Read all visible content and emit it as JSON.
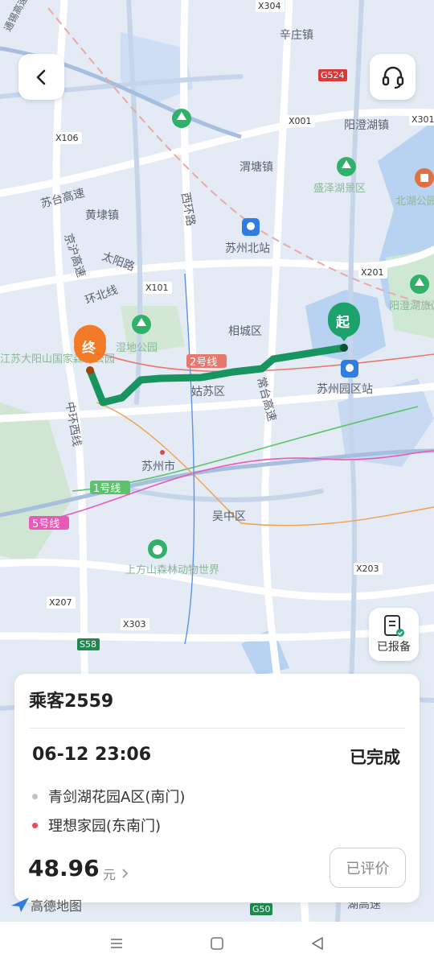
{
  "map": {
    "places": {
      "xinzhuang": "辛庄镇",
      "yangcheng": "阳澄湖镇",
      "weitang": "渭塘镇",
      "shenghu": "盛泽湖景区",
      "huangdai": "黄埭镇",
      "taiyang": "太阳路",
      "xihuan": "西环路",
      "suzhou_north": "苏州北站",
      "xiangcheng": "相城区",
      "gusu": "姑苏区",
      "suzhou_city": "苏州市",
      "wuzhong": "吴中区",
      "sip_station": "苏州园区站",
      "shangfangshan": "上方山森林动物世界",
      "huanbei": "环北线",
      "zhonghuan_west": "中环西线",
      "changtai": "常台高速",
      "sutai": "苏台高速",
      "jinghu": "京沪高速",
      "tonglu": "通锡高速",
      "jiangsu_forest": "江苏大阳山国家森林公园",
      "wetland": "湿地公园",
      "yangcheng_lake": "阳澄湖旅游度假区",
      "beihu": "北湖公园",
      "bottom_road": "湖高速"
    },
    "road_codes": [
      "X304",
      "G524",
      "X106",
      "X001",
      "X301",
      "X101",
      "X201",
      "X203",
      "X207",
      "X303",
      "S58",
      "G50"
    ],
    "metro": {
      "line1": "1号线",
      "line2": "2号线",
      "line5": "5号线"
    },
    "markers": {
      "start": "起",
      "end": "终"
    },
    "colors": {
      "route": "#179460",
      "start_marker": "#1ca26a",
      "end_marker": "#f37a27"
    }
  },
  "report_button": {
    "label": "已报备"
  },
  "trip_card": {
    "passenger": "乘客2559",
    "datetime": "06-12 23:06",
    "status": "已完成",
    "origin": "青剑湖花园A区(南门)",
    "destination": "理想家园(东南门)",
    "price": "48.96",
    "unit": "元",
    "rated_label": "已评价"
  },
  "watermark": {
    "text": "高德地图"
  }
}
